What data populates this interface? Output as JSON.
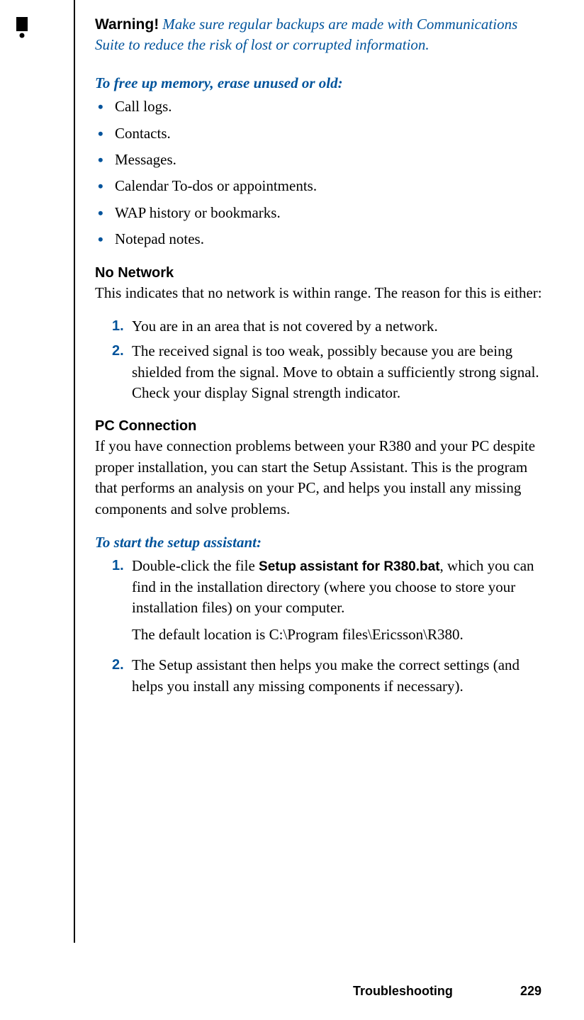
{
  "warning": {
    "label": "Warning!",
    "text": "Make sure regular backups are made with Communications Suite to reduce the risk of lost or corrupted information."
  },
  "free_memory": {
    "title": "To free up memory, erase unused or old:",
    "items": [
      "Call logs.",
      "Contacts.",
      "Messages.",
      "Calendar To-dos or appointments.",
      "WAP history or bookmarks.",
      "Notepad notes."
    ]
  },
  "no_network": {
    "heading": "No Network",
    "intro": "This indicates that no network is within range. The reason for this is either:",
    "items": [
      {
        "num": "1.",
        "text": "You are in an area that is not covered by a network."
      },
      {
        "num": "2.",
        "text": "The received signal is too weak, possibly because you are being shielded from the signal. Move to obtain a sufficiently strong signal. Check your display Signal strength indicator."
      }
    ]
  },
  "pc_connection": {
    "heading": "PC Connection",
    "intro": "If you have connection problems between your R380 and your PC despite proper installation, you can start the Setup Assistant. This is the program that performs an analysis on your PC, and helps you install any missing components and solve problems."
  },
  "setup_assistant": {
    "title": "To start the setup assistant:",
    "items": [
      {
        "num": "1.",
        "pre": "Double-click the file ",
        "bat": "Setup assistant for R380.bat",
        "post": ", which you can find in the installation directory (where you choose to store your installation files) on your computer.",
        "continuation": "The default location is C:\\Program files\\Ericsson\\R380."
      },
      {
        "num": "2.",
        "text": "The Setup assistant then helps you make the correct settings (and helps you install any missing components if necessary)."
      }
    ]
  },
  "footer": {
    "section": "Troubleshooting",
    "page": "229"
  }
}
